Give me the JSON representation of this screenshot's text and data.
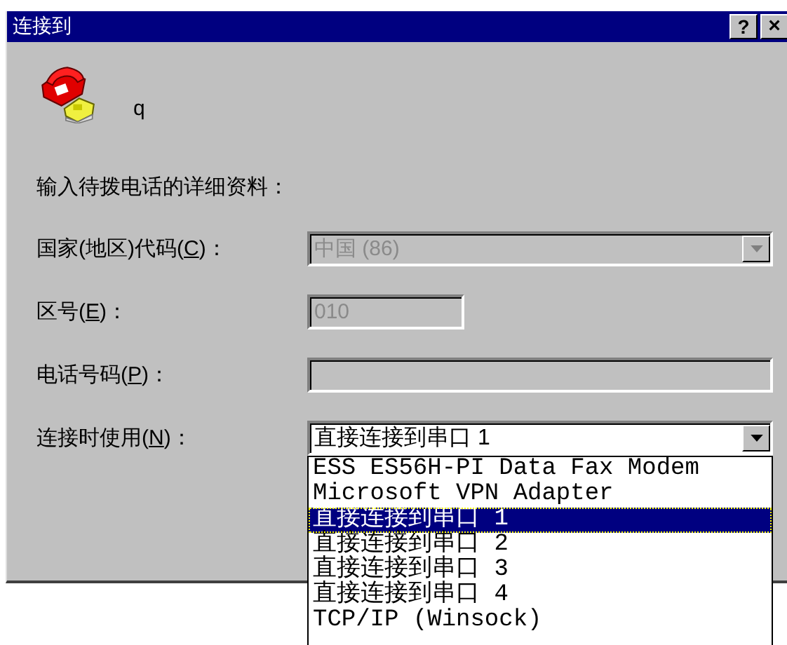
{
  "window": {
    "title": "连接到",
    "buttons": [
      {
        "kind": "help",
        "label": "?"
      },
      {
        "kind": "close",
        "label": "×"
      }
    ]
  },
  "entry_name": "q",
  "intro": "输入待拨电话的详细资料：",
  "fields": [
    {
      "kind": "combo",
      "label_before": "国家(地区)代码(",
      "accel": "C",
      "label_after": ")：",
      "value": "中国 (86)",
      "disabled": true,
      "expanded": false
    },
    {
      "kind": "short",
      "label_before": "区号(",
      "accel": "E",
      "label_after": ")：",
      "value": "010",
      "disabled": true
    },
    {
      "kind": "text",
      "label_before": "电话号码(",
      "accel": "P",
      "label_after": ")：",
      "disabled": true
    },
    {
      "kind": "combo",
      "label_before": "连接时使用(",
      "accel": "N",
      "label_after": ")：",
      "value": "直接连接到串口 1",
      "disabled": false,
      "expanded": true,
      "options": [
        {
          "label": "ESS ES56H-PI Data Fax Modem",
          "selected": false
        },
        {
          "label": "Microsoft VPN Adapter",
          "selected": false
        },
        {
          "label": "直接连接到串口 1",
          "selected": true
        },
        {
          "label": "直接连接到串口 2",
          "selected": false
        },
        {
          "label": "直接连接到串口 3",
          "selected": false
        },
        {
          "label": "直接连接到串口 4",
          "selected": false
        },
        {
          "label": "TCP/IP (Winsock)",
          "selected": false
        }
      ]
    }
  ]
}
